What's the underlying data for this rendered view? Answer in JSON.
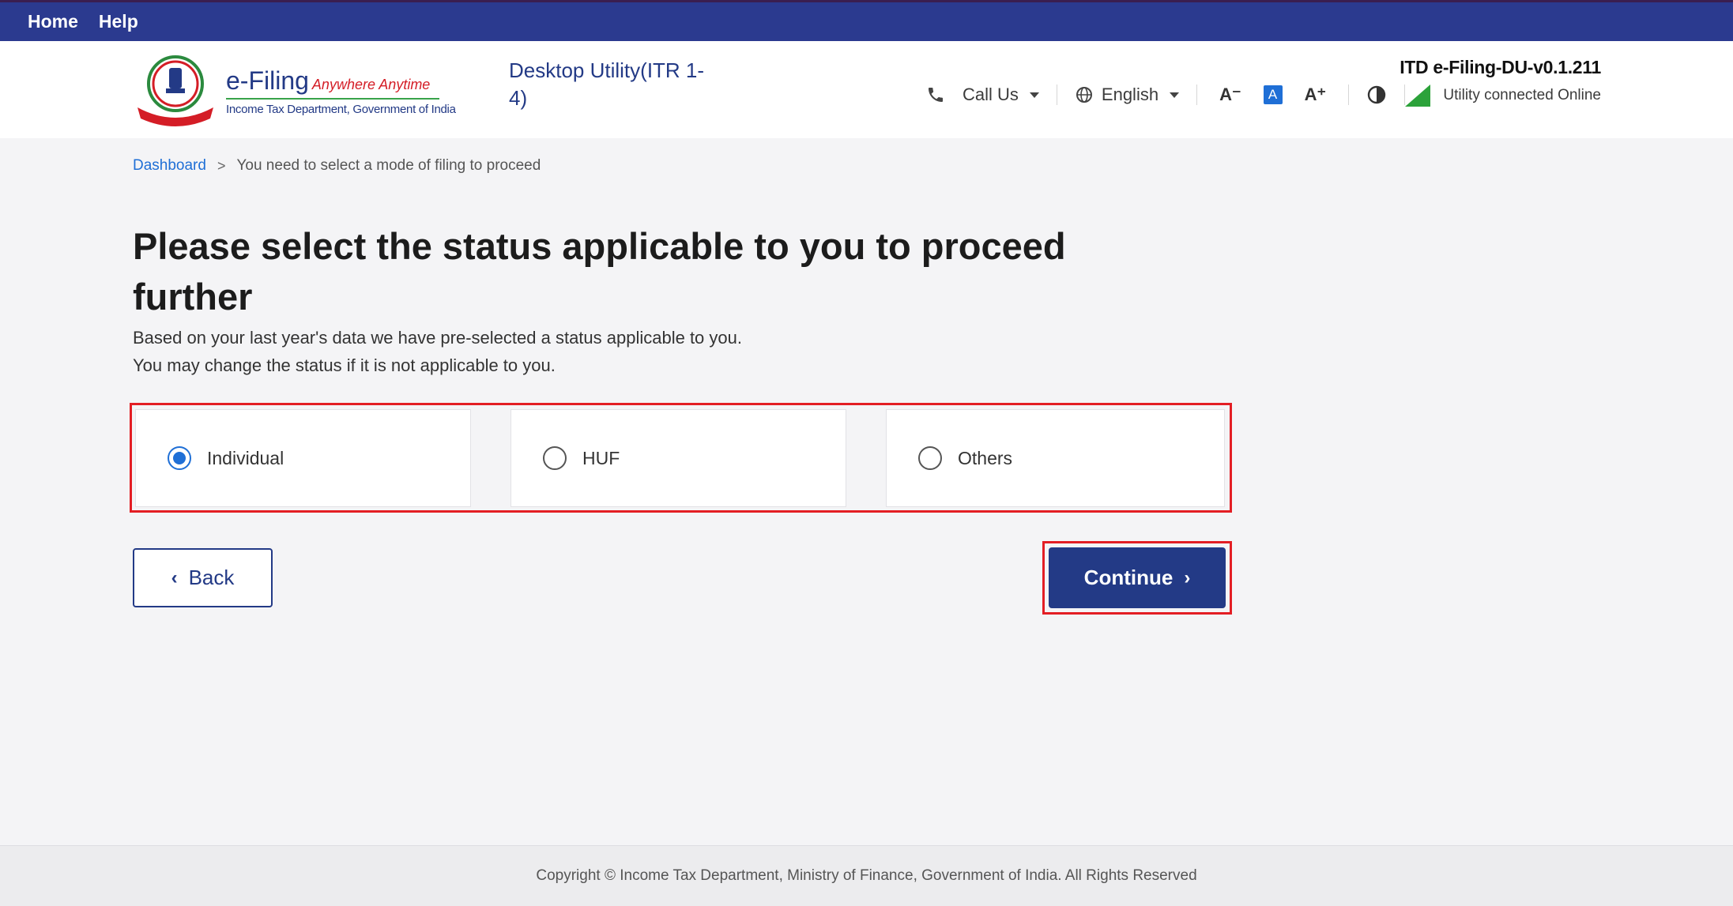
{
  "topnav": {
    "home": "Home",
    "help": "Help"
  },
  "header": {
    "logo_title": "e-Filing",
    "logo_tagline": "Anywhere Anytime",
    "logo_subtitle": "Income Tax Department, Government of India",
    "utility_title": "Desktop Utility(ITR 1-4)",
    "call_us": "Call Us",
    "language": "English",
    "font_decrease": "A⁻",
    "font_default": "A",
    "font_increase": "A⁺",
    "version": "ITD e-Filing-DU-v0.1.211",
    "connection_status": "Utility connected Online"
  },
  "breadcrumb": {
    "root": "Dashboard",
    "current": "You need to select a mode of filing to proceed"
  },
  "main": {
    "title": "Please select the status applicable to you to proceed further",
    "desc_line1": "Based on your last year's data we have pre-selected a status applicable to you.",
    "desc_line2": "You may change the status if it is not applicable to you.",
    "options": [
      {
        "label": "Individual",
        "selected": true
      },
      {
        "label": "HUF",
        "selected": false
      },
      {
        "label": "Others",
        "selected": false
      }
    ],
    "back_label": "Back",
    "continue_label": "Continue"
  },
  "footer": {
    "copyright": "Copyright © Income Tax Department, Ministry of Finance, Government of India. All Rights Reserved"
  },
  "colors": {
    "nav": "#2b3a8f",
    "primary": "#233a86",
    "accent": "#1f6fd6",
    "highlight": "#e31e24",
    "online": "#2ca23a"
  }
}
